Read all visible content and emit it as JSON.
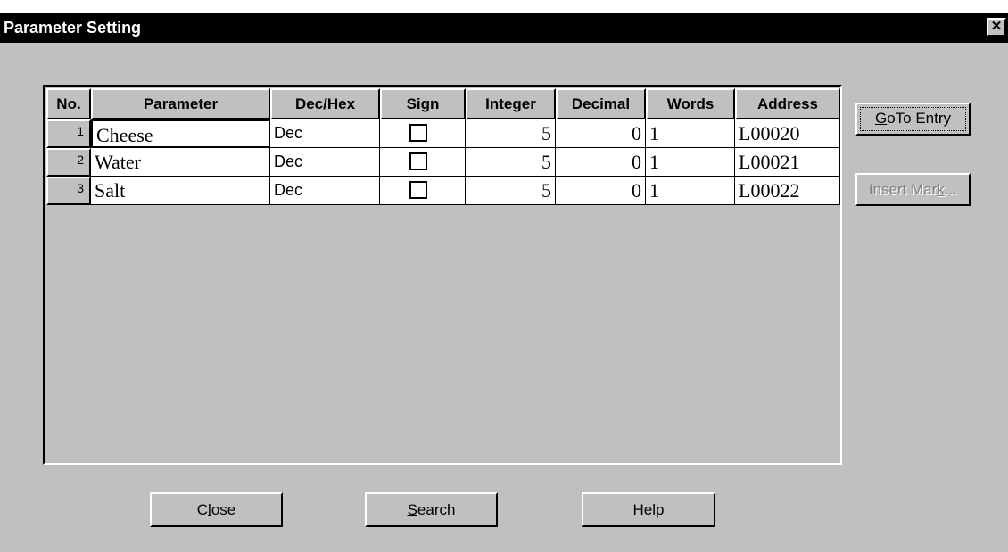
{
  "window": {
    "title": "Parameter Setting",
    "close_label": "✕"
  },
  "table": {
    "columns": [
      "No.",
      "Parameter",
      "Dec/Hex",
      "Sign",
      "Integer",
      "Decimal",
      "Words",
      "Address"
    ],
    "rows": [
      {
        "no": "1",
        "parameter": "Cheese",
        "dechex": "Dec",
        "sign": false,
        "integer": "5",
        "decimal": "0",
        "words": "1",
        "address": "L00020"
      },
      {
        "no": "2",
        "parameter": "Water",
        "dechex": "Dec",
        "sign": false,
        "integer": "5",
        "decimal": "0",
        "words": "1",
        "address": "L00021"
      },
      {
        "no": "3",
        "parameter": "Salt",
        "dechex": "Dec",
        "sign": false,
        "integer": "5",
        "decimal": "0",
        "words": "1",
        "address": "L00022"
      }
    ]
  },
  "side_buttons": {
    "goto_entry": {
      "before": "",
      "mnemonic": "G",
      "after": "oTo Entry"
    },
    "insert_mark": {
      "before": "Insert Mar",
      "mnemonic": "k",
      "after": "..."
    }
  },
  "bottom_buttons": {
    "close": {
      "before": "C",
      "mnemonic": "l",
      "after": "ose"
    },
    "search": {
      "before": "",
      "mnemonic": "S",
      "after": "earch"
    },
    "help": {
      "before": "",
      "mnemonic": "",
      "after": "Help"
    }
  },
  "colors": {
    "face": "#c0c0c0",
    "titlebar": "#000000",
    "disabled_text": "#808080"
  }
}
